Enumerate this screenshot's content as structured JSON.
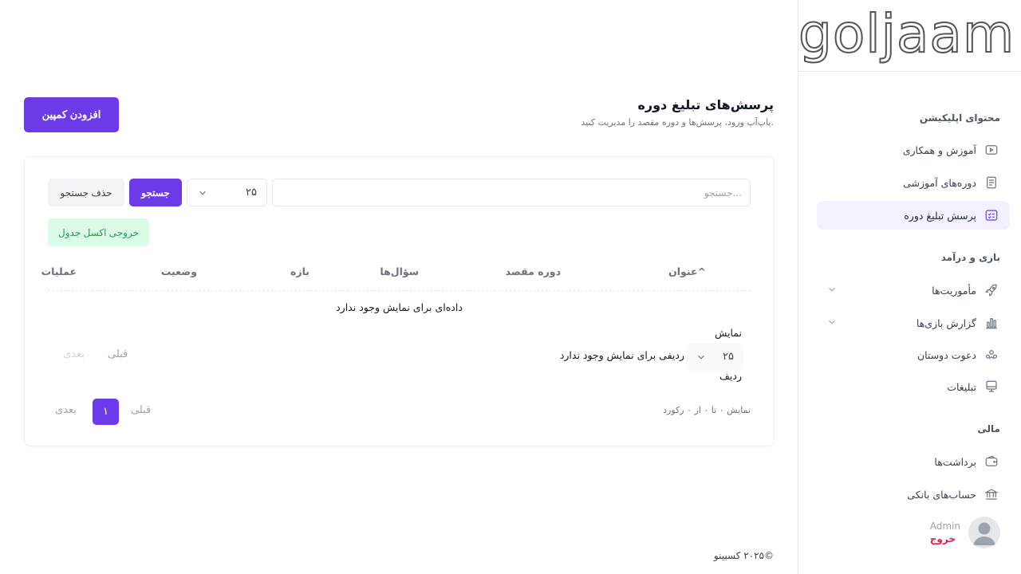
{
  "logo": {
    "text": "goljaam"
  },
  "sidebar": {
    "sections": [
      {
        "title": "محتوای اپلیکیشن"
      },
      {
        "title": "بازی و درآمد"
      },
      {
        "title": "مالی"
      }
    ],
    "items": [
      {
        "label": "آموزش و همکاری",
        "icon": "video-icon"
      },
      {
        "label": "دوره‌های آموزشی",
        "icon": "document-icon"
      },
      {
        "label": "پرسش تبلیغ دوره",
        "icon": "checklist-icon",
        "active": true
      },
      {
        "label": "مأموریت‌ها",
        "icon": "rocket-icon"
      },
      {
        "label": "گزارش بازی‌ها",
        "icon": "bar-chart-icon"
      },
      {
        "label": "دعوت دوستان",
        "icon": "users-icon"
      },
      {
        "label": "تبلیغات",
        "icon": "screen-icon"
      },
      {
        "label": "برداشت‌ها",
        "icon": "wallet-icon"
      },
      {
        "label": "حساب‌های بانکی",
        "icon": "bank-icon"
      }
    ],
    "user": {
      "name": "Admin",
      "logout": "خروج"
    }
  },
  "header": {
    "title": "پرسش‌های تبلیغ دوره",
    "subtitle": "پاپ‌آپ ورود، پرسش‌ها و دوره مقصد را مدیریت کنید.",
    "add_button": "افزودن کمپین"
  },
  "filters": {
    "search_placeholder": "جستجو...",
    "per_page": "۲۵",
    "search_button": "جستجو",
    "clear_button": "حذف جستجو",
    "excel_button": "خروجی اکسل جدول"
  },
  "table": {
    "columns": [
      "عنوان^",
      "دوره مقصد",
      "سؤال‌ها",
      "بازه",
      "وضعیت",
      "عملیات"
    ],
    "empty_message": "داده‌ای برای نمایش وجود ندارد"
  },
  "pagination_top": {
    "show_label": "نمایش",
    "rows_label": "ردیف",
    "per_page": "۲۵",
    "no_rows": "ردیفی برای نمایش وجود ندارد",
    "prev": "قبلی",
    "next": "بعدی"
  },
  "pagination_bottom": {
    "range": "نمایش ۰ تا ۰ از ۰ رکورد",
    "prev": "قبلی",
    "page": "۱",
    "next": "بعدی"
  },
  "footer": {
    "text": "©۲۰۲۵ کسبینو"
  },
  "colors": {
    "primary": "#6d3ae7",
    "success_bg": "#dcfce7",
    "success_text": "#16a34a",
    "danger": "#e11d48"
  }
}
